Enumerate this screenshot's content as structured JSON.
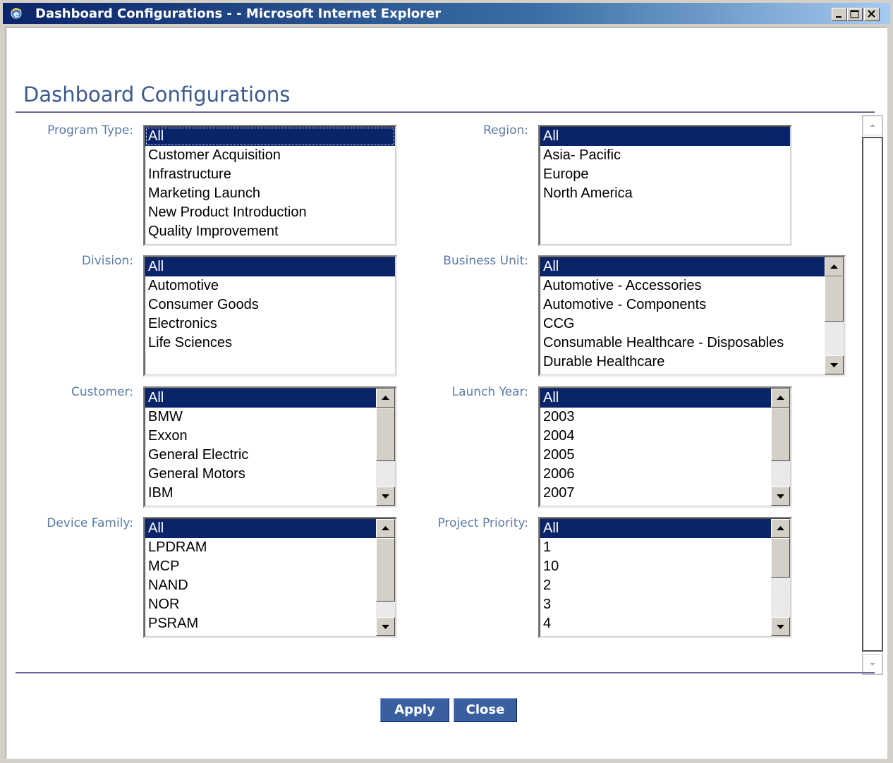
{
  "window": {
    "title": "Dashboard Configurations - - Microsoft Internet Explorer"
  },
  "page": {
    "title": "Dashboard Configurations"
  },
  "filters": {
    "program_type": {
      "label": "Program Type:",
      "options": [
        "All",
        "Customer Acquisition",
        "Infrastructure",
        "Marketing Launch",
        "New Product Introduction",
        "Quality Improvement"
      ],
      "selected": "All"
    },
    "region": {
      "label": "Region:",
      "options": [
        "All",
        "Asia- Pacific",
        "Europe",
        "North America"
      ],
      "selected": "All"
    },
    "division": {
      "label": "Division:",
      "options": [
        "All",
        "Automotive",
        "Consumer Goods",
        "Electronics",
        "Life Sciences"
      ],
      "selected": "All"
    },
    "business_unit": {
      "label": "Business Unit:",
      "options": [
        "All",
        "Automotive - Accessories",
        "Automotive - Components",
        "CCG",
        "Consumable Healthcare - Disposables",
        "Durable Healthcare"
      ],
      "selected": "All"
    },
    "customer": {
      "label": "Customer:",
      "options": [
        "All",
        "BMW",
        "Exxon",
        "General Electric",
        "General Motors",
        "IBM"
      ],
      "selected": "All"
    },
    "launch_year": {
      "label": "Launch Year:",
      "options": [
        "All",
        "2003",
        "2004",
        "2005",
        "2006",
        "2007"
      ],
      "selected": "All"
    },
    "device_family": {
      "label": "Device Family:",
      "options": [
        "All",
        "LPDRAM",
        "MCP",
        "NAND",
        "NOR",
        "PSRAM"
      ],
      "selected": "All"
    },
    "project_priority": {
      "label": "Project Priority:",
      "options": [
        "All",
        "1",
        "10",
        "2",
        "3",
        "4"
      ],
      "selected": "All"
    }
  },
  "buttons": {
    "apply": "Apply",
    "close": "Close"
  },
  "colors": {
    "titlebar": "#0a246a",
    "selection": "#0a246a",
    "label": "#5a7aa5",
    "heading": "#3c5a8a",
    "button": "#3a5fa0"
  }
}
